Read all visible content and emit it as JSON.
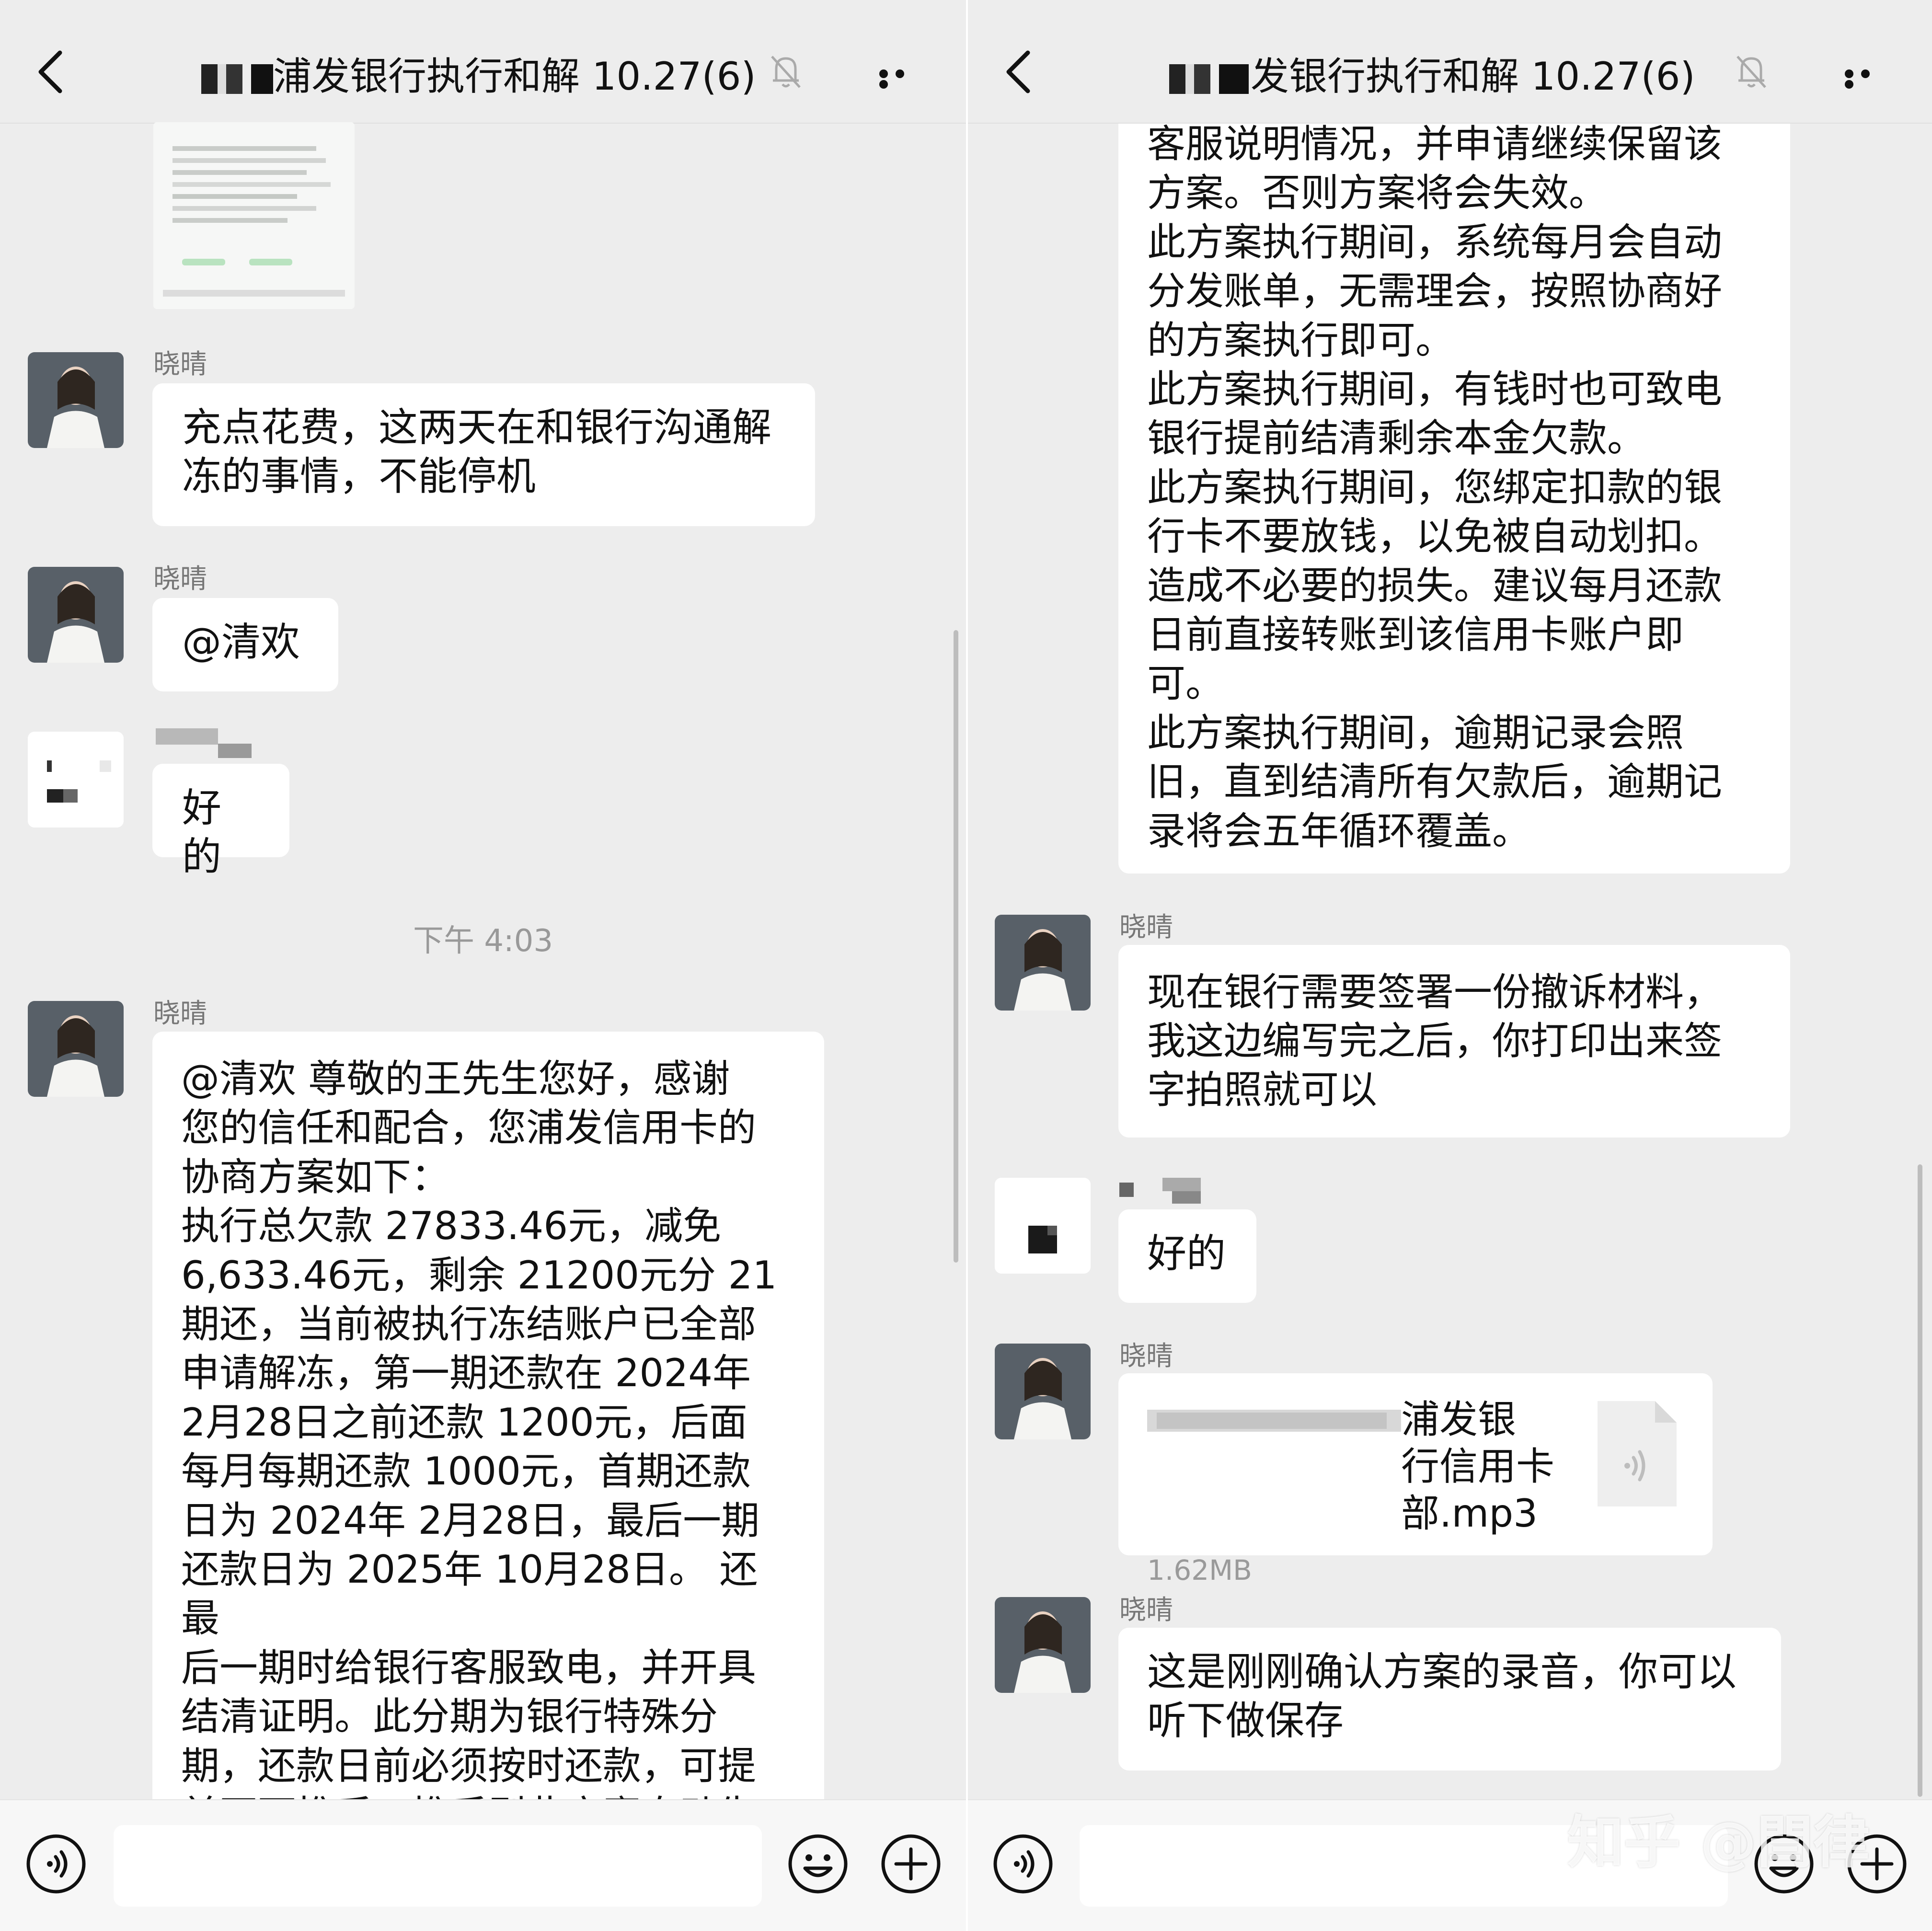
{
  "header": {
    "title_left": "浦发银行执行和解 10.27(6)",
    "title_right": "发银行执行和解 10.27(6)"
  },
  "colors": {
    "background": "#ededed",
    "bubble": "#ffffff",
    "name_text": "#777777",
    "time_text": "#999999"
  },
  "icons": {
    "back": "chevron-left-icon",
    "mute": "bell-off-icon",
    "more": "more-dots-icon",
    "voice": "voice-icon",
    "emoji": "emoji-icon",
    "plus": "plus-icon",
    "audio_file": "audio-file-icon"
  },
  "left_messages": [
    {
      "sender": "晓晴",
      "text": "充点花费，这两天在和银行沟通解\n冻的事情，不能停机"
    },
    {
      "sender": "晓晴",
      "text": "@清欢"
    },
    {
      "sender": "",
      "text": "好的"
    },
    {
      "sender": "晓晴",
      "text": "@清欢 尊敬的王先生您好，感谢\n您的信任和配合，您浦发信用卡的\n协商方案如下：\n执行总欠款 27833.46元，减免\n6,633.46元，剩余 21200元分 21\n期还，当前被执行冻结账户已全部\n申请解冻，第一期还款在 2024年\n2月28日之前还款 1200元，后面\n每月每期还款 1000元，首期还款\n日为 2024年 2月28日，最后一期\n还款日为 2025年 10月28日。 还最\n后一期时给银行客服致电，并开具\n结清证明。此分期为银行特殊分\n期，还款日前必须按时还款，可提\n前不可推后，推后则此方案自动失"
    }
  ],
  "left_time": "下午 4:03",
  "right_messages": [
    {
      "sender": "",
      "text": "客服说明情况，并申请继续保留该\n方案。否则方案将会失效。\n此方案执行期间，系统每月会自动\n分发账单，无需理会，按照协商好\n的方案执行即可。\n此方案执行期间，有钱时也可致电\n银行提前结清剩余本金欠款。\n此方案执行期间，您绑定扣款的银\n行卡不要放钱，以免被自动划扣。\n造成不必要的损失。建议每月还款\n日前直接转账到该信用卡账户即\n可。\n此方案执行期间，逾期记录会照\n旧，直到结清所有欠款后，逾期记\n录将会五年循环覆盖。"
    },
    {
      "sender": "晓晴",
      "text": "现在银行需要签署一份撤诉材料，\n我这边编写完之后，你打印出来签\n字拍照就可以"
    },
    {
      "sender": "",
      "text": "好的"
    },
    {
      "sender": "晓晴",
      "file_name": "浦发银\n行信用卡部.mp3",
      "file_size": "1.62MB"
    },
    {
      "sender": "晓晴",
      "text": "这是刚刚确认方案的录音，你可以\n听下做保存"
    }
  ],
  "watermark": "知乎 @閆律"
}
